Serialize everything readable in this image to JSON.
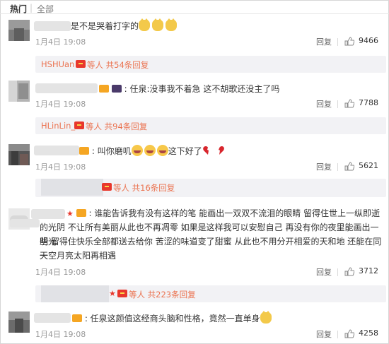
{
  "tabs": {
    "hot": "热门",
    "separator": "|",
    "all": "全部"
  },
  "actions": {
    "reply": "回复"
  },
  "comments": [
    {
      "text": "是不是哭着打字的",
      "date": "1月4日 19:08",
      "likes": "9466",
      "sub": {
        "user": "HSHUan",
        "count": "等人 共54条回复"
      }
    },
    {
      "text": "任泉:没事我不着急 这不胡歌还没主了吗",
      "date": "1月4日 19:08",
      "likes": "7788",
      "sub": {
        "user": "HLinLin_",
        "count": "等人 共94条回复"
      }
    },
    {
      "text": "叫你磨叽",
      "text_tail": "这下好了",
      "date": "1月4日 19:08",
      "likes": "5621",
      "sub": {
        "user": "",
        "count": "等人 共16条回复"
      }
    },
    {
      "line1": "谁能告诉我有没有这样的笔  能画出一双双不流泪的眼睛  留得住世上一纵即逝",
      "line2": "的光阴  不让所有美丽从此也不再凋零  如果是这样我可以安慰自己  再没有你的夜里能画出一些光",
      "line3": "明  留得住快乐全部都送去给你  苦涩的味道变了甜蜜  从此也不用分开相爱的天和地  还能在同一",
      "line4": "天空月亮太阳再相遇",
      "date": "1月4日 19:08",
      "likes": "3712",
      "sub": {
        "user": "",
        "count": "等人 共223条回复"
      }
    },
    {
      "text": "任泉这颜值这经商头脑和性格，竟然一直单身",
      "date": "1月4日 19:08",
      "likes": "4258"
    }
  ],
  "colors": {
    "accent": "#eb7350",
    "badge": "#e8372c",
    "sub_bg": "#f2f2f5"
  }
}
